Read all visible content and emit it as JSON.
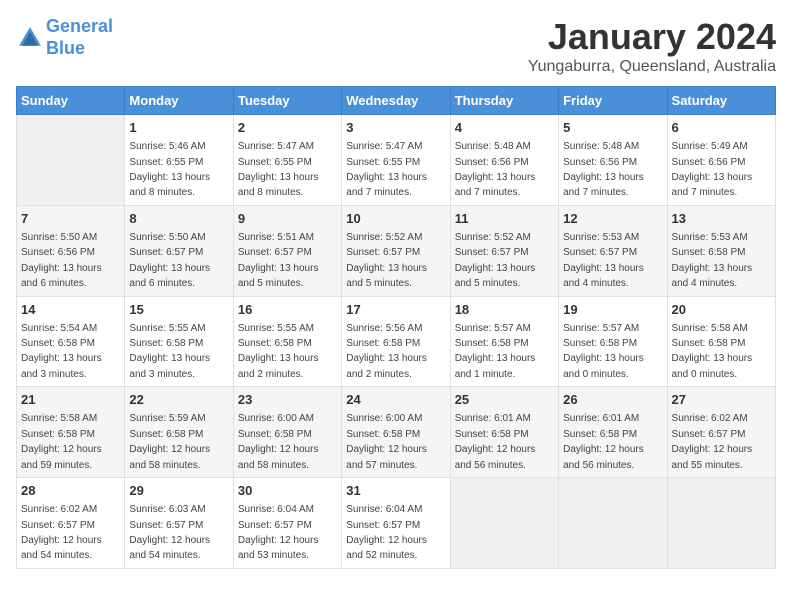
{
  "header": {
    "logo_line1": "General",
    "logo_line2": "Blue",
    "month": "January 2024",
    "location": "Yungaburra, Queensland, Australia"
  },
  "days_of_week": [
    "Sunday",
    "Monday",
    "Tuesday",
    "Wednesday",
    "Thursday",
    "Friday",
    "Saturday"
  ],
  "weeks": [
    [
      {
        "day": "",
        "sunrise": "",
        "sunset": "",
        "daylight": ""
      },
      {
        "day": "1",
        "sunrise": "Sunrise: 5:46 AM",
        "sunset": "Sunset: 6:55 PM",
        "daylight": "Daylight: 13 hours and 8 minutes."
      },
      {
        "day": "2",
        "sunrise": "Sunrise: 5:47 AM",
        "sunset": "Sunset: 6:55 PM",
        "daylight": "Daylight: 13 hours and 8 minutes."
      },
      {
        "day": "3",
        "sunrise": "Sunrise: 5:47 AM",
        "sunset": "Sunset: 6:55 PM",
        "daylight": "Daylight: 13 hours and 7 minutes."
      },
      {
        "day": "4",
        "sunrise": "Sunrise: 5:48 AM",
        "sunset": "Sunset: 6:56 PM",
        "daylight": "Daylight: 13 hours and 7 minutes."
      },
      {
        "day": "5",
        "sunrise": "Sunrise: 5:48 AM",
        "sunset": "Sunset: 6:56 PM",
        "daylight": "Daylight: 13 hours and 7 minutes."
      },
      {
        "day": "6",
        "sunrise": "Sunrise: 5:49 AM",
        "sunset": "Sunset: 6:56 PM",
        "daylight": "Daylight: 13 hours and 7 minutes."
      }
    ],
    [
      {
        "day": "7",
        "sunrise": "Sunrise: 5:50 AM",
        "sunset": "Sunset: 6:56 PM",
        "daylight": "Daylight: 13 hours and 6 minutes."
      },
      {
        "day": "8",
        "sunrise": "Sunrise: 5:50 AM",
        "sunset": "Sunset: 6:57 PM",
        "daylight": "Daylight: 13 hours and 6 minutes."
      },
      {
        "day": "9",
        "sunrise": "Sunrise: 5:51 AM",
        "sunset": "Sunset: 6:57 PM",
        "daylight": "Daylight: 13 hours and 5 minutes."
      },
      {
        "day": "10",
        "sunrise": "Sunrise: 5:52 AM",
        "sunset": "Sunset: 6:57 PM",
        "daylight": "Daylight: 13 hours and 5 minutes."
      },
      {
        "day": "11",
        "sunrise": "Sunrise: 5:52 AM",
        "sunset": "Sunset: 6:57 PM",
        "daylight": "Daylight: 13 hours and 5 minutes."
      },
      {
        "day": "12",
        "sunrise": "Sunrise: 5:53 AM",
        "sunset": "Sunset: 6:57 PM",
        "daylight": "Daylight: 13 hours and 4 minutes."
      },
      {
        "day": "13",
        "sunrise": "Sunrise: 5:53 AM",
        "sunset": "Sunset: 6:58 PM",
        "daylight": "Daylight: 13 hours and 4 minutes."
      }
    ],
    [
      {
        "day": "14",
        "sunrise": "Sunrise: 5:54 AM",
        "sunset": "Sunset: 6:58 PM",
        "daylight": "Daylight: 13 hours and 3 minutes."
      },
      {
        "day": "15",
        "sunrise": "Sunrise: 5:55 AM",
        "sunset": "Sunset: 6:58 PM",
        "daylight": "Daylight: 13 hours and 3 minutes."
      },
      {
        "day": "16",
        "sunrise": "Sunrise: 5:55 AM",
        "sunset": "Sunset: 6:58 PM",
        "daylight": "Daylight: 13 hours and 2 minutes."
      },
      {
        "day": "17",
        "sunrise": "Sunrise: 5:56 AM",
        "sunset": "Sunset: 6:58 PM",
        "daylight": "Daylight: 13 hours and 2 minutes."
      },
      {
        "day": "18",
        "sunrise": "Sunrise: 5:57 AM",
        "sunset": "Sunset: 6:58 PM",
        "daylight": "Daylight: 13 hours and 1 minute."
      },
      {
        "day": "19",
        "sunrise": "Sunrise: 5:57 AM",
        "sunset": "Sunset: 6:58 PM",
        "daylight": "Daylight: 13 hours and 0 minutes."
      },
      {
        "day": "20",
        "sunrise": "Sunrise: 5:58 AM",
        "sunset": "Sunset: 6:58 PM",
        "daylight": "Daylight: 13 hours and 0 minutes."
      }
    ],
    [
      {
        "day": "21",
        "sunrise": "Sunrise: 5:58 AM",
        "sunset": "Sunset: 6:58 PM",
        "daylight": "Daylight: 12 hours and 59 minutes."
      },
      {
        "day": "22",
        "sunrise": "Sunrise: 5:59 AM",
        "sunset": "Sunset: 6:58 PM",
        "daylight": "Daylight: 12 hours and 58 minutes."
      },
      {
        "day": "23",
        "sunrise": "Sunrise: 6:00 AM",
        "sunset": "Sunset: 6:58 PM",
        "daylight": "Daylight: 12 hours and 58 minutes."
      },
      {
        "day": "24",
        "sunrise": "Sunrise: 6:00 AM",
        "sunset": "Sunset: 6:58 PM",
        "daylight": "Daylight: 12 hours and 57 minutes."
      },
      {
        "day": "25",
        "sunrise": "Sunrise: 6:01 AM",
        "sunset": "Sunset: 6:58 PM",
        "daylight": "Daylight: 12 hours and 56 minutes."
      },
      {
        "day": "26",
        "sunrise": "Sunrise: 6:01 AM",
        "sunset": "Sunset: 6:58 PM",
        "daylight": "Daylight: 12 hours and 56 minutes."
      },
      {
        "day": "27",
        "sunrise": "Sunrise: 6:02 AM",
        "sunset": "Sunset: 6:57 PM",
        "daylight": "Daylight: 12 hours and 55 minutes."
      }
    ],
    [
      {
        "day": "28",
        "sunrise": "Sunrise: 6:02 AM",
        "sunset": "Sunset: 6:57 PM",
        "daylight": "Daylight: 12 hours and 54 minutes."
      },
      {
        "day": "29",
        "sunrise": "Sunrise: 6:03 AM",
        "sunset": "Sunset: 6:57 PM",
        "daylight": "Daylight: 12 hours and 54 minutes."
      },
      {
        "day": "30",
        "sunrise": "Sunrise: 6:04 AM",
        "sunset": "Sunset: 6:57 PM",
        "daylight": "Daylight: 12 hours and 53 minutes."
      },
      {
        "day": "31",
        "sunrise": "Sunrise: 6:04 AM",
        "sunset": "Sunset: 6:57 PM",
        "daylight": "Daylight: 12 hours and 52 minutes."
      },
      {
        "day": "",
        "sunrise": "",
        "sunset": "",
        "daylight": ""
      },
      {
        "day": "",
        "sunrise": "",
        "sunset": "",
        "daylight": ""
      },
      {
        "day": "",
        "sunrise": "",
        "sunset": "",
        "daylight": ""
      }
    ]
  ]
}
